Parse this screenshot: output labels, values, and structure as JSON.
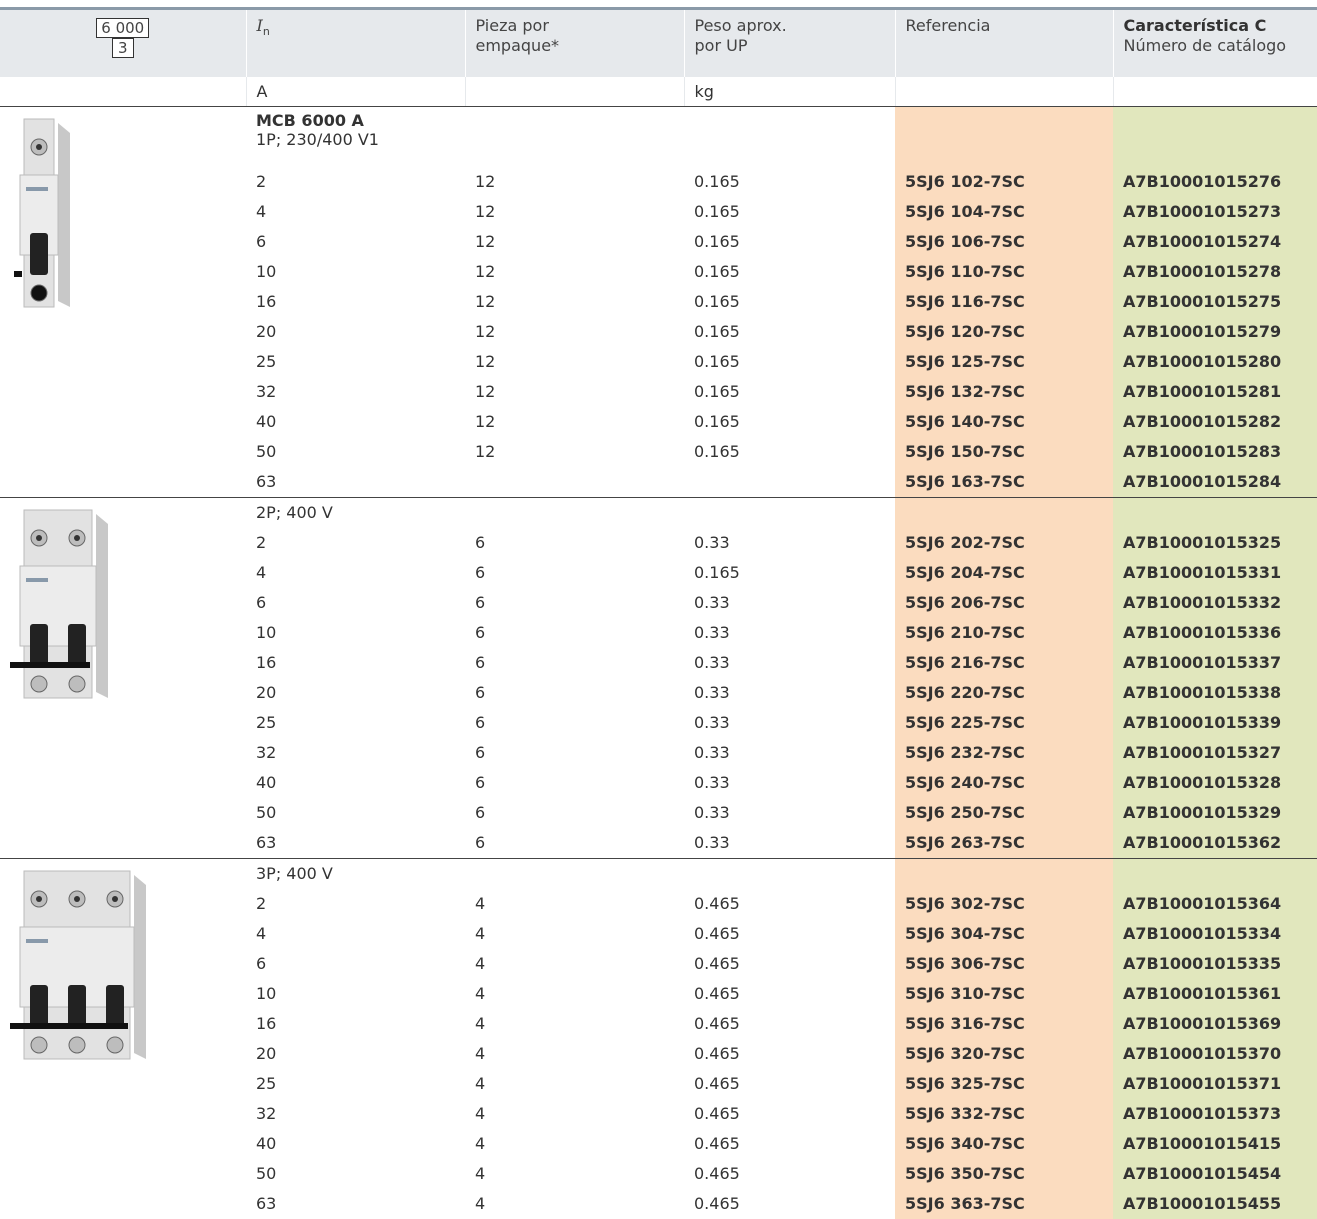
{
  "header": {
    "rating_top": "6 000",
    "rating_bottom": "3",
    "col_in_letter": "I",
    "col_in_sub": "n",
    "col_pieces": [
      "Pieza por",
      "empaque*"
    ],
    "col_weight": [
      "Peso aprox.",
      "por UP"
    ],
    "col_reference": "Referencia",
    "col_char_title": "Característica C",
    "col_char_sub": "Número de catálogo",
    "unit_in": "A",
    "unit_weight": "kg"
  },
  "colors": {
    "reference_bg": "#fbdcbf",
    "catalog_bg": "#e1e7bd",
    "header_bg": "#e6e9ec"
  },
  "sections": [
    {
      "icon": "mcb-1-pole-icon",
      "title": "MCB 6000 A",
      "subtitle": "1P; 230/400 V1",
      "rows": [
        {
          "in": "2",
          "pcs": "12",
          "kg": "0.165",
          "ref": "5SJ6 102-7SC",
          "cat": "A7B10001015276"
        },
        {
          "in": "4",
          "pcs": "12",
          "kg": "0.165",
          "ref": "5SJ6 104-7SC",
          "cat": "A7B10001015273"
        },
        {
          "in": "6",
          "pcs": "12",
          "kg": "0.165",
          "ref": "5SJ6 106-7SC",
          "cat": "A7B10001015274"
        },
        {
          "in": "10",
          "pcs": "12",
          "kg": "0.165",
          "ref": "5SJ6 110-7SC",
          "cat": "A7B10001015278"
        },
        {
          "in": "16",
          "pcs": "12",
          "kg": "0.165",
          "ref": "5SJ6 116-7SC",
          "cat": "A7B10001015275"
        },
        {
          "in": "20",
          "pcs": "12",
          "kg": "0.165",
          "ref": "5SJ6 120-7SC",
          "cat": "A7B10001015279"
        },
        {
          "in": "25",
          "pcs": "12",
          "kg": "0.165",
          "ref": "5SJ6 125-7SC",
          "cat": "A7B10001015280"
        },
        {
          "in": "32",
          "pcs": "12",
          "kg": "0.165",
          "ref": "5SJ6 132-7SC",
          "cat": "A7B10001015281"
        },
        {
          "in": "40",
          "pcs": "12",
          "kg": "0.165",
          "ref": "5SJ6 140-7SC",
          "cat": "A7B10001015282"
        },
        {
          "in": "50",
          "pcs": "12",
          "kg": "0.165",
          "ref": "5SJ6 150-7SC",
          "cat": "A7B10001015283"
        },
        {
          "in": "63",
          "pcs": "",
          "kg": "",
          "ref": "5SJ6 163-7SC",
          "cat": "A7B10001015284"
        }
      ]
    },
    {
      "icon": "mcb-2-pole-icon",
      "title": "",
      "subtitle": "2P; 400 V",
      "rows": [
        {
          "in": "2",
          "pcs": "6",
          "kg": "0.33",
          "ref": "5SJ6 202-7SC",
          "cat": "A7B10001015325"
        },
        {
          "in": "4",
          "pcs": "6",
          "kg": "0.165",
          "ref": "5SJ6 204-7SC",
          "cat": "A7B10001015331"
        },
        {
          "in": "6",
          "pcs": "6",
          "kg": "0.33",
          "ref": "5SJ6 206-7SC",
          "cat": "A7B10001015332"
        },
        {
          "in": "10",
          "pcs": "6",
          "kg": "0.33",
          "ref": "5SJ6 210-7SC",
          "cat": "A7B10001015336"
        },
        {
          "in": "16",
          "pcs": "6",
          "kg": "0.33",
          "ref": "5SJ6 216-7SC",
          "cat": "A7B10001015337"
        },
        {
          "in": "20",
          "pcs": "6",
          "kg": "0.33",
          "ref": "5SJ6 220-7SC",
          "cat": "A7B10001015338"
        },
        {
          "in": "25",
          "pcs": "6",
          "kg": "0.33",
          "ref": "5SJ6 225-7SC",
          "cat": "A7B10001015339"
        },
        {
          "in": "32",
          "pcs": "6",
          "kg": "0.33",
          "ref": "5SJ6 232-7SC",
          "cat": "A7B10001015327"
        },
        {
          "in": "40",
          "pcs": "6",
          "kg": "0.33",
          "ref": "5SJ6 240-7SC",
          "cat": "A7B10001015328"
        },
        {
          "in": "50",
          "pcs": "6",
          "kg": "0.33",
          "ref": "5SJ6 250-7SC",
          "cat": "A7B10001015329"
        },
        {
          "in": "63",
          "pcs": "6",
          "kg": "0.33",
          "ref": "5SJ6 263-7SC",
          "cat": "A7B10001015362"
        }
      ]
    },
    {
      "icon": "mcb-3-pole-icon",
      "title": "",
      "subtitle": "3P; 400 V",
      "rows": [
        {
          "in": "2",
          "pcs": "4",
          "kg": "0.465",
          "ref": "5SJ6 302-7SC",
          "cat": "A7B10001015364"
        },
        {
          "in": "4",
          "pcs": "4",
          "kg": "0.465",
          "ref": "5SJ6 304-7SC",
          "cat": "A7B10001015334"
        },
        {
          "in": "6",
          "pcs": "4",
          "kg": "0.465",
          "ref": "5SJ6 306-7SC",
          "cat": "A7B10001015335"
        },
        {
          "in": "10",
          "pcs": "4",
          "kg": "0.465",
          "ref": "5SJ6 310-7SC",
          "cat": "A7B10001015361"
        },
        {
          "in": "16",
          "pcs": "4",
          "kg": "0.465",
          "ref": "5SJ6 316-7SC",
          "cat": "A7B10001015369"
        },
        {
          "in": "20",
          "pcs": "4",
          "kg": "0.465",
          "ref": "5SJ6 320-7SC",
          "cat": "A7B10001015370"
        },
        {
          "in": "25",
          "pcs": "4",
          "kg": "0.465",
          "ref": "5SJ6 325-7SC",
          "cat": "A7B10001015371"
        },
        {
          "in": "32",
          "pcs": "4",
          "kg": "0.465",
          "ref": "5SJ6 332-7SC",
          "cat": "A7B10001015373"
        },
        {
          "in": "40",
          "pcs": "4",
          "kg": "0.465",
          "ref": "5SJ6 340-7SC",
          "cat": "A7B10001015415"
        },
        {
          "in": "50",
          "pcs": "4",
          "kg": "0.465",
          "ref": "5SJ6 350-7SC",
          "cat": "A7B10001015454"
        },
        {
          "in": "63",
          "pcs": "4",
          "kg": "0.465",
          "ref": "5SJ6 363-7SC",
          "cat": "A7B10001015455"
        }
      ]
    }
  ]
}
